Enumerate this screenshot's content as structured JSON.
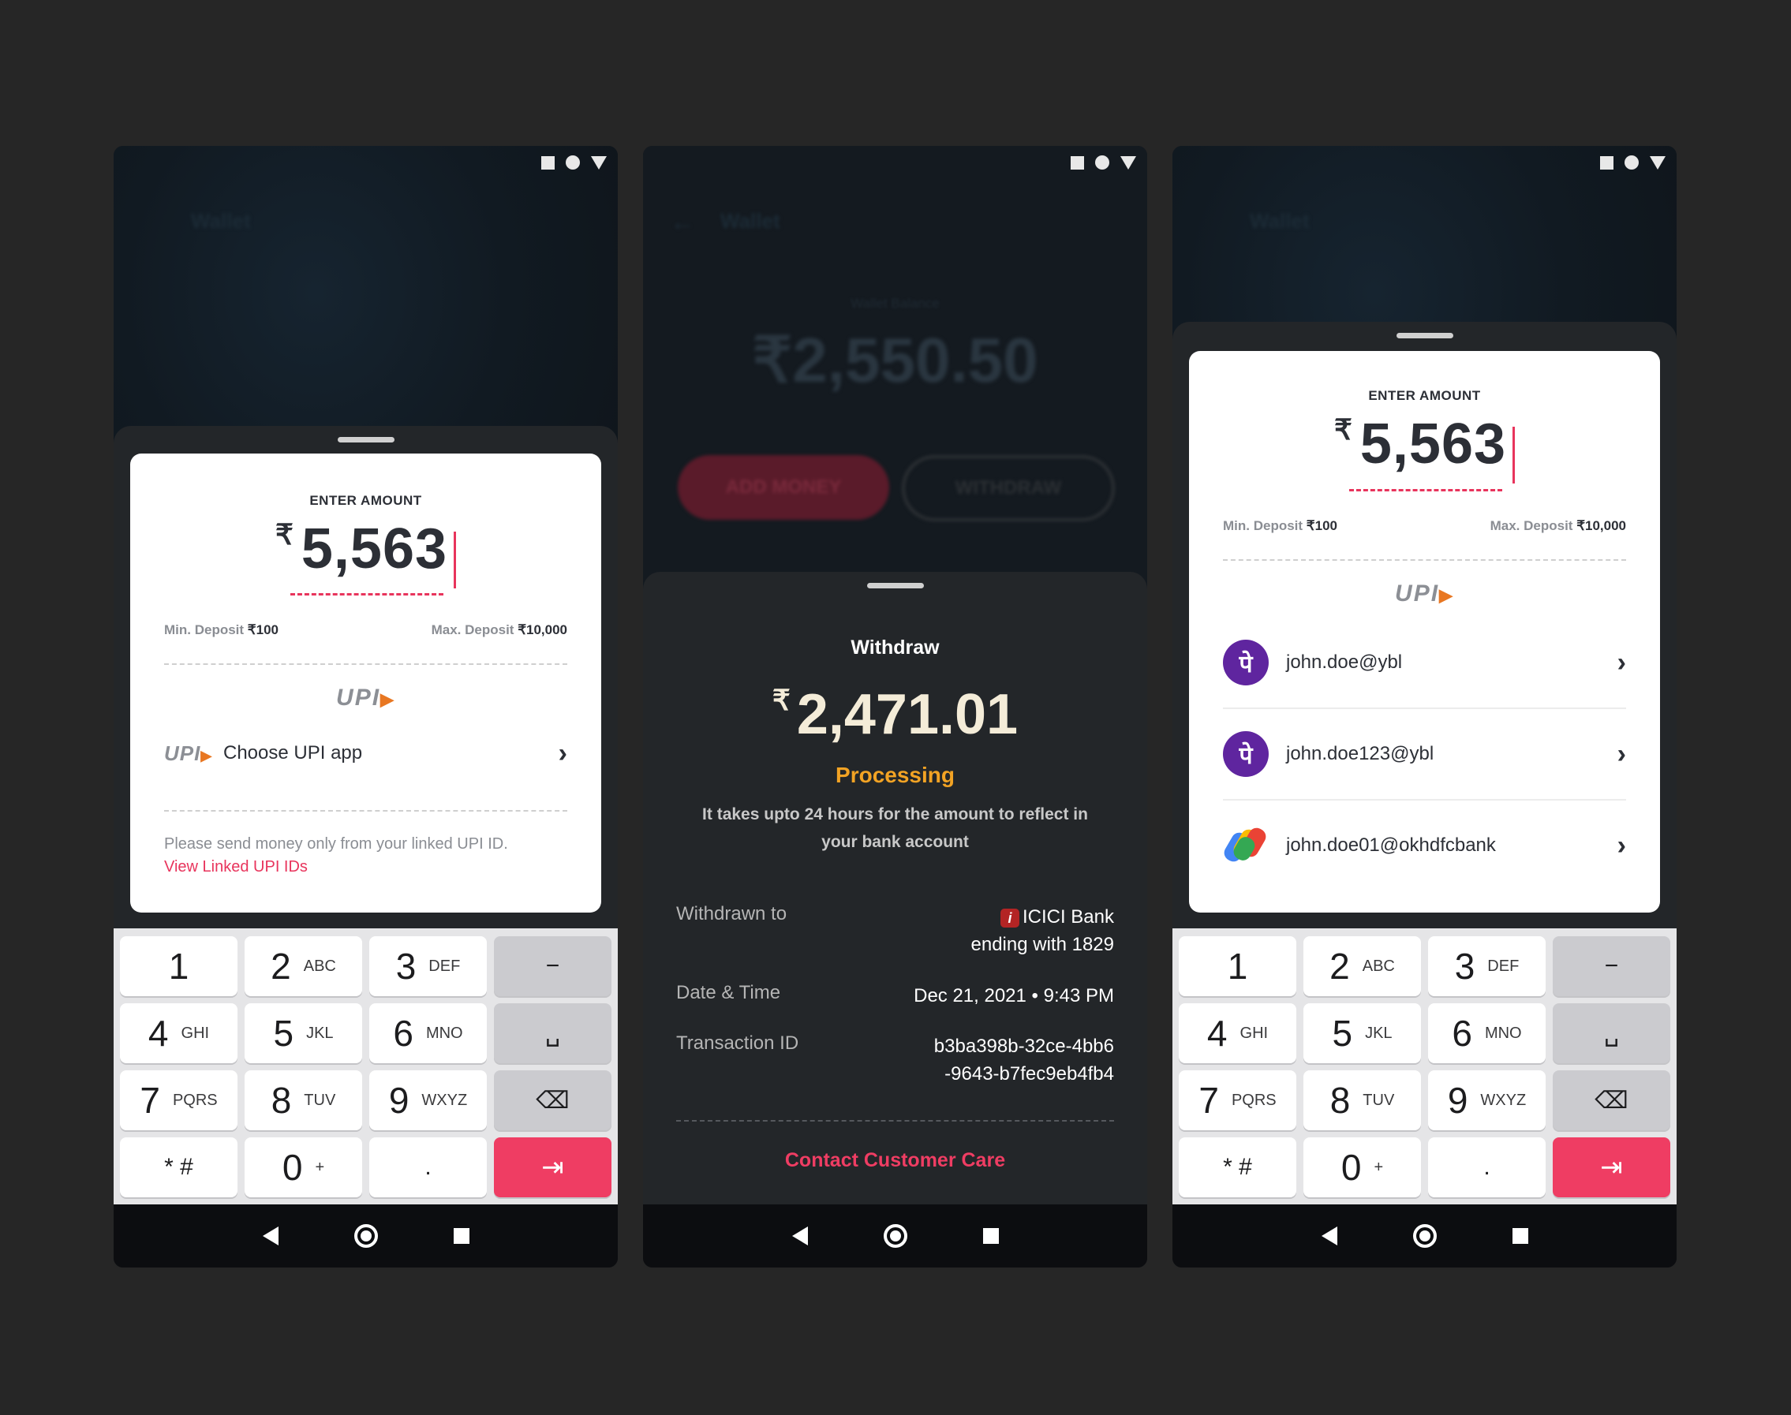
{
  "colors": {
    "accent": "#ef3d63",
    "processing": "#f2a324",
    "phonepe": "#5f259f"
  },
  "left": {
    "header_title": "Wallet",
    "enter_label": "ENTER AMOUNT",
    "currency": "₹",
    "amount": "5,563",
    "min_label": "Min. Deposit",
    "min_value": "₹100",
    "max_label": "Max. Deposit",
    "max_value": "₹10,000",
    "upi_logo": "UPI",
    "choose_label": "Choose UPI app",
    "note": "Please send money only from your linked UPI ID.",
    "link": "View Linked UPI IDs"
  },
  "middle": {
    "header_title": "Wallet",
    "balance_label": "Wallet Balance",
    "balance_value": "₹2,550.50",
    "add_money": "ADD MONEY",
    "withdraw_btn": "WITHDRAW",
    "title": "Withdraw",
    "currency": "₹",
    "amount": "2,471.01",
    "status": "Processing",
    "note": "It takes upto 24 hours for the amount to reflect in your bank account",
    "withdrawn_to_label": "Withdrawn to",
    "bank_name": "ICICI Bank",
    "bank_ending": "ending with 1829",
    "datetime_label": "Date & Time",
    "datetime_value": "Dec 21, 2021 • 9:43 PM",
    "txn_label": "Transaction ID",
    "txn_line1": "b3ba398b-32ce-4bb6",
    "txn_line2": "-9643-b7fec9eb4fb4",
    "contact": "Contact Customer Care"
  },
  "right": {
    "header_title": "Wallet",
    "enter_label": "ENTER AMOUNT",
    "currency": "₹",
    "amount": "5,563",
    "min_label": "Min. Deposit",
    "min_value": "₹100",
    "max_label": "Max. Deposit",
    "max_value": "₹10,000",
    "upi_logo": "UPI",
    "vpas": [
      {
        "app": "PhonePe",
        "glyph": "पे",
        "address": "john.doe@ybl"
      },
      {
        "app": "PhonePe",
        "glyph": "पे",
        "address": "john.doe123@ybl"
      },
      {
        "app": "Google Pay",
        "glyph": "",
        "address": "john.doe01@okhdfcbank"
      }
    ]
  },
  "keypad": {
    "keys": [
      {
        "n": "1",
        "l": ""
      },
      {
        "n": "2",
        "l": "ABC"
      },
      {
        "n": "3",
        "l": "DEF"
      },
      {
        "n": "−",
        "l": ""
      },
      {
        "n": "4",
        "l": "GHI"
      },
      {
        "n": "5",
        "l": "JKL"
      },
      {
        "n": "6",
        "l": "MNO"
      },
      {
        "n": "␣",
        "l": ""
      },
      {
        "n": "7",
        "l": "PQRS"
      },
      {
        "n": "8",
        "l": "TUV"
      },
      {
        "n": "9",
        "l": "WXYZ"
      },
      {
        "n": "⌫",
        "l": ""
      },
      {
        "n": "* #",
        "l": ""
      },
      {
        "n": "0",
        "l": "+"
      },
      {
        "n": ".",
        "l": ""
      },
      {
        "n": "⇥",
        "l": ""
      }
    ]
  },
  "icons": {
    "status": [
      "square-icon",
      "circle-icon",
      "triangle-icon"
    ],
    "nav": [
      "back-icon",
      "home-icon",
      "recents-icon"
    ]
  }
}
